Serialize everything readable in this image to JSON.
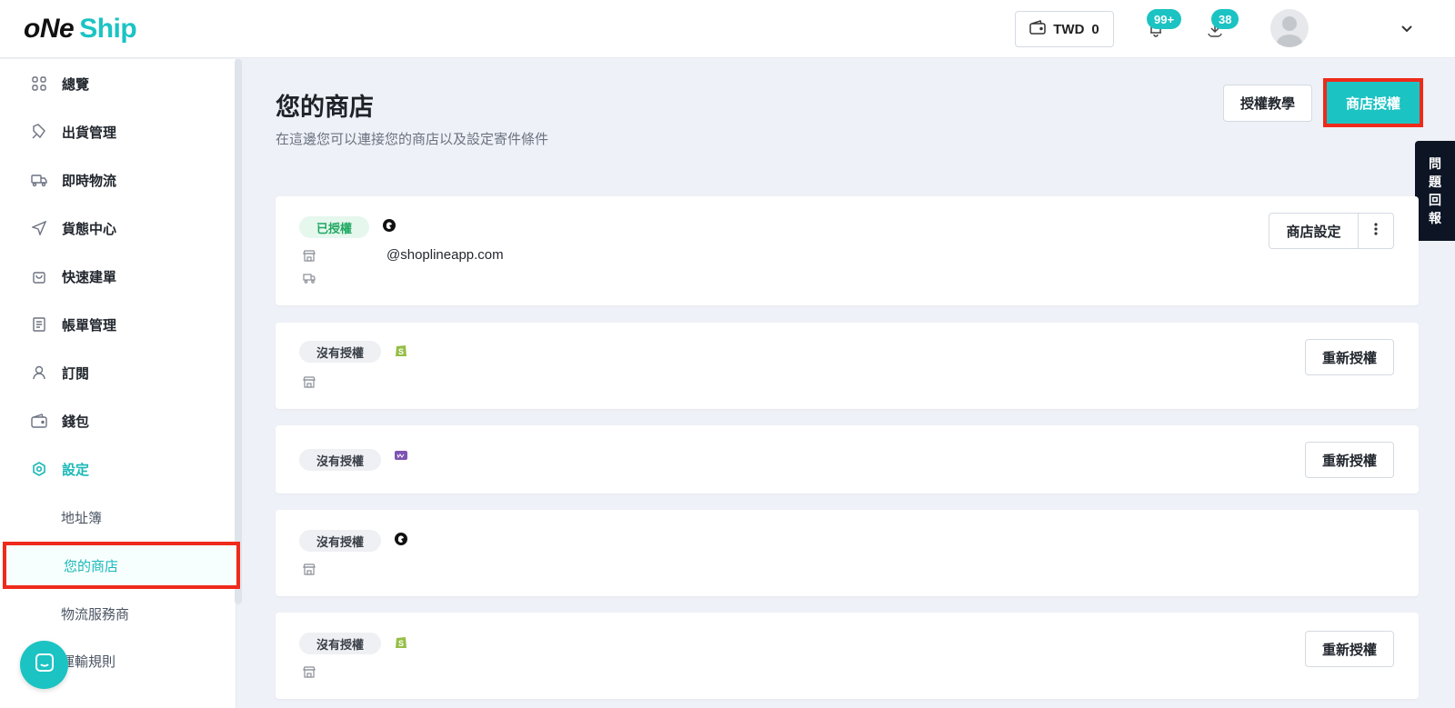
{
  "header": {
    "logo_one": "oNe",
    "logo_ship": "Ship",
    "wallet": {
      "currency": "TWD",
      "amount": "0"
    },
    "notifications_badge": "99+",
    "downloads_badge": "38"
  },
  "sidebar": {
    "items": [
      {
        "label": "總覽",
        "icon": "grid-icon"
      },
      {
        "label": "出貨管理",
        "icon": "package-icon"
      },
      {
        "label": "即時物流",
        "icon": "truck-icon"
      },
      {
        "label": "貨態中心",
        "icon": "send-icon"
      },
      {
        "label": "快速建單",
        "icon": "bag-icon"
      },
      {
        "label": "帳單管理",
        "icon": "document-icon"
      },
      {
        "label": "訂閱",
        "icon": "user-icon"
      },
      {
        "label": "錢包",
        "icon": "wallet-icon"
      },
      {
        "label": "設定",
        "icon": "settings-icon"
      }
    ],
    "sub_items": [
      {
        "label": "地址簿"
      },
      {
        "label": "您的商店"
      },
      {
        "label": "物流服務商"
      },
      {
        "label": "運輸規則"
      }
    ]
  },
  "main": {
    "title": "您的商店",
    "subtitle": "在這邊您可以連接您的商店以及設定寄件條件",
    "tutorial_button": "授權教學",
    "authorize_button": "商店授權",
    "feedback_tab": [
      "問",
      "題",
      "回",
      "報"
    ],
    "stores": [
      {
        "status": "已授權",
        "platform": "shopline-icon",
        "email": "@shoplineapp.com",
        "settings_button": "商店設定"
      },
      {
        "status": "沒有授權",
        "platform": "shopify-icon",
        "action": "重新授權"
      },
      {
        "status": "沒有授權",
        "platform": "woocommerce-icon",
        "action": "重新授權"
      },
      {
        "status": "沒有授權",
        "platform": "shopline-icon"
      },
      {
        "status": "沒有授權",
        "platform": "shopify-icon",
        "action": "重新授權"
      }
    ]
  },
  "colors": {
    "accent": "#1cc3c3",
    "highlight": "#ee2a1b",
    "authorized": "#1fa862"
  }
}
